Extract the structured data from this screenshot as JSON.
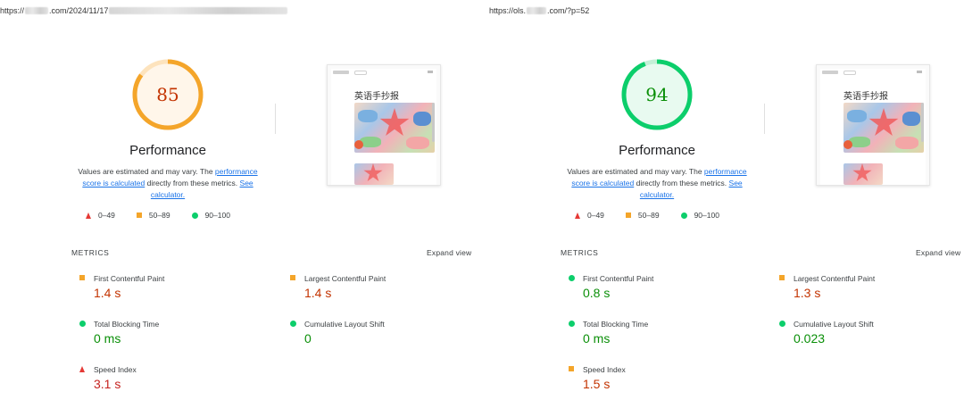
{
  "colors": {
    "fail": "#e53935",
    "average": "#f4a52a",
    "pass": "#0cce6b",
    "fail_text": "#c5221f",
    "average_text": "#c33300",
    "pass_text": "#0a8f08",
    "link": "#1a73e8"
  },
  "panels": [
    {
      "url_prefix": "https://",
      "url_middle": ".com/2024/11/17",
      "url_suffix": "",
      "score": 85,
      "score_status": "average",
      "title": "Performance",
      "note": {
        "text1": "Values are estimated and may vary. The ",
        "link1": "performance score is calculated",
        "text2": " directly from these metrics. ",
        "link2": "See calculator."
      },
      "thumbnail_title": "英语手抄报",
      "legend": [
        {
          "icon": "triangle-icon",
          "label": "0–49"
        },
        {
          "icon": "square-icon",
          "label": "50–89"
        },
        {
          "icon": "circle-icon",
          "label": "90–100"
        }
      ],
      "metrics_header": "METRICS",
      "expand_label": "Expand view",
      "metrics": [
        {
          "label": "First Contentful Paint",
          "value": "1.4 s",
          "status": "average"
        },
        {
          "label": "Largest Contentful Paint",
          "value": "1.4 s",
          "status": "average"
        },
        {
          "label": "Total Blocking Time",
          "value": "0 ms",
          "status": "pass"
        },
        {
          "label": "Cumulative Layout Shift",
          "value": "0",
          "status": "pass"
        },
        {
          "label": "Speed Index",
          "value": "3.1 s",
          "status": "fail"
        }
      ]
    },
    {
      "url_prefix": "https://ols.",
      "url_middle": ".com/?p=52",
      "url_suffix": "",
      "score": 94,
      "score_status": "pass",
      "title": "Performance",
      "note": {
        "text1": "Values are estimated and may vary. The ",
        "link1": "performance score is calculated",
        "text2": " directly from these metrics. ",
        "link2": "See calculator."
      },
      "thumbnail_title": "英语手抄报",
      "legend": [
        {
          "icon": "triangle-icon",
          "label": "0–49"
        },
        {
          "icon": "square-icon",
          "label": "50–89"
        },
        {
          "icon": "circle-icon",
          "label": "90–100"
        }
      ],
      "metrics_header": "METRICS",
      "expand_label": "Expand view",
      "metrics": [
        {
          "label": "First Contentful Paint",
          "value": "0.8 s",
          "status": "pass"
        },
        {
          "label": "Largest Contentful Paint",
          "value": "1.3 s",
          "status": "average"
        },
        {
          "label": "Total Blocking Time",
          "value": "0 ms",
          "status": "pass"
        },
        {
          "label": "Cumulative Layout Shift",
          "value": "0.023",
          "status": "pass"
        },
        {
          "label": "Speed Index",
          "value": "1.5 s",
          "status": "average"
        }
      ]
    }
  ]
}
